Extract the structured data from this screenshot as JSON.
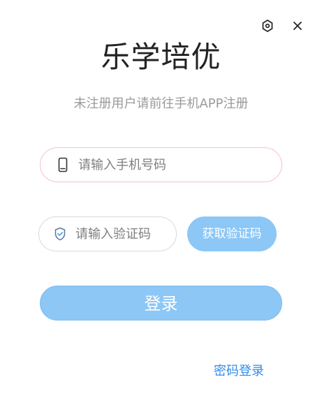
{
  "window": {
    "settings_icon": "settings-icon",
    "close_icon": "close-icon"
  },
  "header": {
    "title": "乐学培优",
    "subtitle": "未注册用户请前往手机APP注册"
  },
  "form": {
    "phone": {
      "placeholder": "请输入手机号码",
      "icon": "phone-icon",
      "border_color": "#f4c2c7"
    },
    "code": {
      "placeholder": "请输入验证码",
      "icon": "shield-check-icon",
      "border_color": "#d8d8d8"
    },
    "get_code_label": "获取验证码",
    "login_label": "登录",
    "password_login_label": "密码登录"
  },
  "colors": {
    "primary_button": "#8cc7f6",
    "link": "#2f8bea",
    "title": "#222222",
    "subtitle": "#9a9a9a"
  }
}
